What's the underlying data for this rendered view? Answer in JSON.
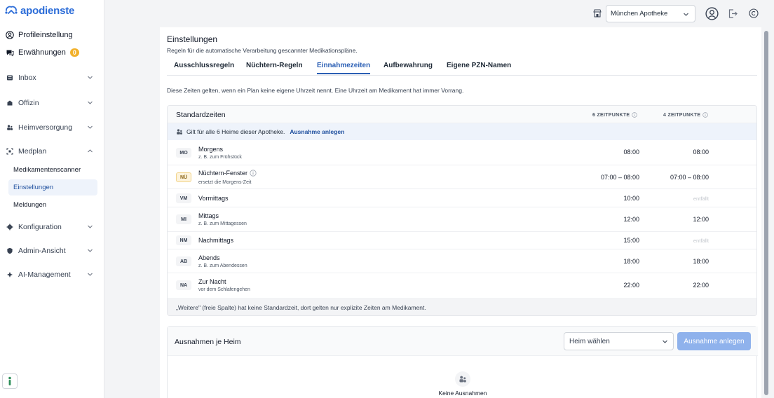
{
  "brand": {
    "name": "apodienste",
    "color": "#2b6cd8"
  },
  "sidebar": {
    "top": [
      {
        "label": "Profileinstellung",
        "icon": "user-circle-icon"
      },
      {
        "label": "Erwähnungen",
        "icon": "chat-icon",
        "badge": "0"
      }
    ],
    "items": [
      {
        "label": "Inbox",
        "icon": "inbox-icon",
        "expanded": false
      },
      {
        "label": "Offizin",
        "icon": "store-icon",
        "expanded": false
      },
      {
        "label": "Heimversorgung",
        "icon": "people-icon",
        "expanded": false
      },
      {
        "label": "Medplan",
        "icon": "scan-icon",
        "expanded": true
      },
      {
        "label": "Konfiguration",
        "icon": "gear-icon",
        "expanded": false
      },
      {
        "label": "Admin-Ansicht",
        "icon": "shield-icon",
        "expanded": false
      },
      {
        "label": "AI-Management",
        "icon": "ai-icon",
        "expanded": false
      }
    ],
    "sub_items": [
      {
        "label": "Medikamentenscanner",
        "active": false
      },
      {
        "label": "Einstellungen",
        "active": true
      },
      {
        "label": "Meldungen",
        "active": false
      }
    ]
  },
  "topbar": {
    "pharmacy": "München Apotheke"
  },
  "page": {
    "title": "Einstellungen",
    "subtitle": "Regeln für die automatische Verarbeitung gescannter Medikationspläne.",
    "tabs": [
      {
        "label": "Ausschlussregeln",
        "active": false
      },
      {
        "label": "Nüchtern-Regeln",
        "active": false
      },
      {
        "label": "Einnahmezeiten",
        "active": true
      },
      {
        "label": "Aufbewahrung",
        "active": false
      },
      {
        "label": "Eigene PZN-Namen",
        "active": false
      }
    ],
    "info": "Diese Zeiten gelten, wenn ein Plan keine eigene Uhrzeit nennt. Eine Uhrzeit am Medikament hat immer Vorrang."
  },
  "standard": {
    "title": "Standardzeiten",
    "col1": "6 ZEITPUNKTE",
    "col2": "4 ZEITPUNKTE",
    "notice": "Gilt für alle 6 Heime dieser Apotheke.",
    "notice_link": "Ausnahme anlegen",
    "rows": [
      {
        "code": "MO",
        "name": "Morgens",
        "hint": "z. B. zum Frühstück",
        "t6": "08:00",
        "t4": "08:00"
      },
      {
        "code": "NÜ",
        "name": "Nüchtern-Fenster",
        "hint": "ersetzt die Morgens-Zeit",
        "t6": "07:00 – 08:00",
        "t4": "07:00 – 08:00"
      },
      {
        "code": "VM",
        "name": "Vormittags",
        "hint": "",
        "t6": "10:00",
        "t4": "entfällt"
      },
      {
        "code": "MI",
        "name": "Mittags",
        "hint": "z. B. zum Mittagessen",
        "t6": "12:00",
        "t4": "12:00"
      },
      {
        "code": "NM",
        "name": "Nachmittags",
        "hint": "",
        "t6": "15:00",
        "t4": "entfällt"
      },
      {
        "code": "AB",
        "name": "Abends",
        "hint": "z. B. zum Abendessen",
        "t6": "18:00",
        "t4": "18:00"
      },
      {
        "code": "NA",
        "name": "Zur Nacht",
        "hint": "vor dem Schlafengehen",
        "t6": "22:00",
        "t4": "22:00"
      }
    ],
    "footer": "„Weitere\" (freie Spalte) hat keine Standardzeit, dort gelten nur explizite Zeiten am Medikament."
  },
  "exceptions": {
    "title": "Ausnahmen je Heim",
    "select_placeholder": "Heim wählen",
    "button": "Ausnahme anlegen",
    "empty": "Keine Ausnahmen"
  },
  "colors": {
    "accent": "#2b5fb4",
    "badge": "#f2b12b",
    "button_disabled": "#8fb2ec"
  }
}
